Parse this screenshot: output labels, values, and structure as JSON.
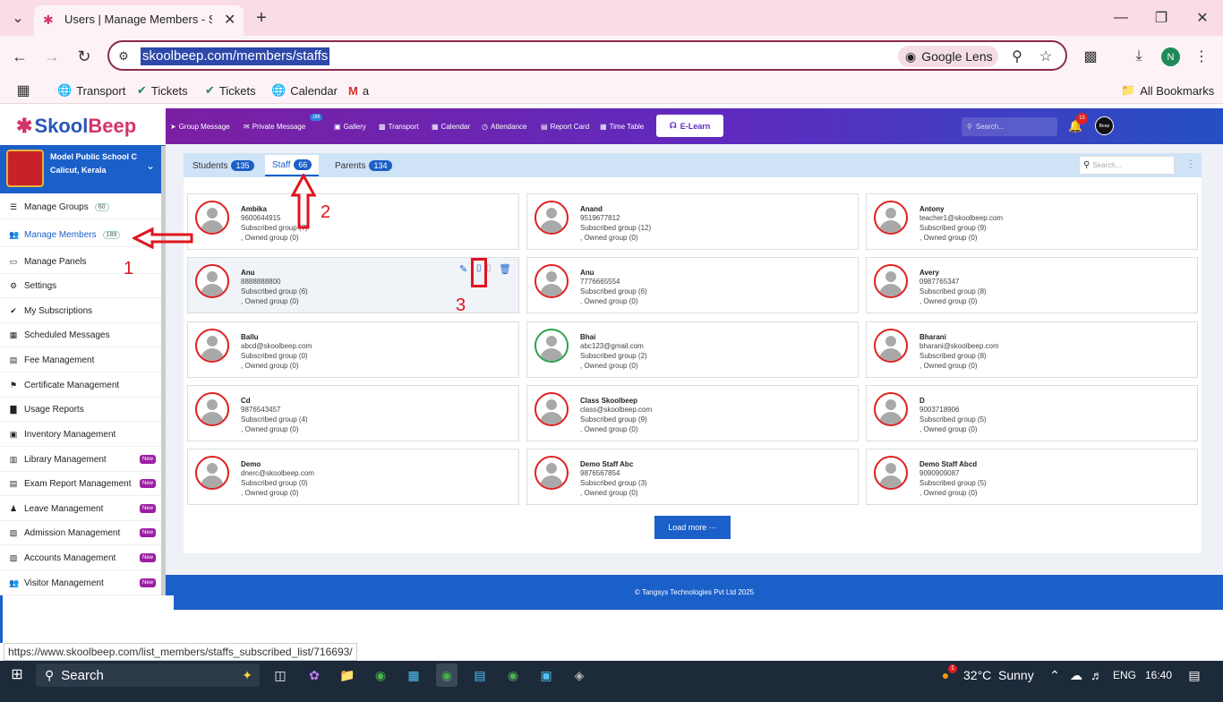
{
  "browser": {
    "tab_title": "Users | Manage Members - Staf",
    "url": "skoolbeep.com/members/staffs",
    "lens_label": "Google Lens",
    "profile_initial": "N",
    "bookmarks": [
      "Transport",
      "Tickets",
      "Tickets",
      "Calendar",
      "a"
    ],
    "all_bookmarks": "All Bookmarks",
    "status_url": "https://www.skoolbeep.com/list_members/staffs_subscribed_list/716693/"
  },
  "app": {
    "logo_a": "Skool",
    "logo_b": "Beep",
    "school_name": "Model Public School C",
    "school_location": "Calicut, Kerala",
    "topnav": [
      "Group Message",
      "Private Message",
      "Gallery",
      "Transport",
      "Calendar",
      "Attendance",
      "Report Card",
      "Time Table"
    ],
    "private_msg_badge": "189",
    "elearn": "E-Learn",
    "search_placeholder": "Search...",
    "notif_count": "15",
    "avatar_label": "Beep"
  },
  "sidebar": {
    "items": [
      {
        "label": "Manage Groups",
        "icon": "list-icon",
        "count": "60",
        "new": ""
      },
      {
        "label": "Manage Members",
        "icon": "users-icon",
        "count": "189",
        "new": ""
      },
      {
        "label": "Manage Panels",
        "icon": "monitor-icon",
        "count": "",
        "new": ""
      },
      {
        "label": "Settings",
        "icon": "gear-icon",
        "count": "",
        "new": ""
      },
      {
        "label": "My Subscriptions",
        "icon": "check-icon",
        "count": "",
        "new": ""
      },
      {
        "label": "Scheduled Messages",
        "icon": "calendar-icon",
        "count": "",
        "new": ""
      },
      {
        "label": "Fee Management",
        "icon": "file-icon",
        "count": "",
        "new": ""
      },
      {
        "label": "Certificate Management",
        "icon": "certificate-icon",
        "count": "",
        "new": ""
      },
      {
        "label": "Usage Reports",
        "icon": "chart-icon",
        "count": "",
        "new": ""
      },
      {
        "label": "Inventory Management",
        "icon": "box-icon",
        "count": "",
        "new": ""
      },
      {
        "label": "Library Management",
        "icon": "book-icon",
        "count": "",
        "new": "New"
      },
      {
        "label": "Exam Report Management",
        "icon": "report-icon",
        "count": "",
        "new": "New"
      },
      {
        "label": "Leave Management",
        "icon": "leave-icon",
        "count": "",
        "new": "New"
      },
      {
        "label": "Admission Management",
        "icon": "admission-icon",
        "count": "",
        "new": "New"
      },
      {
        "label": "Accounts Management",
        "icon": "accounts-icon",
        "count": "",
        "new": "New"
      },
      {
        "label": "Visitor Management",
        "icon": "visitor-icon",
        "count": "",
        "new": "New"
      }
    ]
  },
  "tabs": [
    {
      "label": "Students",
      "count": "135"
    },
    {
      "label": "Staff",
      "count": "66"
    },
    {
      "label": "Parents",
      "count": "134"
    }
  ],
  "list_search_placeholder": "Search...",
  "members": [
    {
      "name": "Ambika",
      "contact": "9600644915",
      "subscribed": "Subscribed group (7)",
      "owned": ", Owned group (0)"
    },
    {
      "name": "Anand",
      "contact": "9519677812",
      "subscribed": "Subscribed group (12)",
      "owned": ", Owned group (0)"
    },
    {
      "name": "Antony",
      "contact": "teacher1@skoolbeep.com",
      "subscribed": "Subscribed group (9)",
      "owned": ", Owned group (0)"
    },
    {
      "name": "Anu",
      "contact": "8888888800",
      "subscribed": "Subscribed group (6)",
      "owned": ", Owned group (0)"
    },
    {
      "name": "Anu",
      "contact": "7776665554",
      "subscribed": "Subscribed group (6)",
      "owned": ", Owned group (0)"
    },
    {
      "name": "Avery",
      "contact": "0987765347",
      "subscribed": "Subscribed group (8)",
      "owned": ", Owned group (0)"
    },
    {
      "name": "Ballu",
      "contact": "abcd@skoolbeep.com",
      "subscribed": "Subscribed group (0)",
      "owned": ", Owned group (0)"
    },
    {
      "name": "Bhai",
      "contact": "abc123@gmail.com",
      "subscribed": "Subscribed group (2)",
      "owned": ", Owned group (0)"
    },
    {
      "name": "Bharani",
      "contact": "bharani@skoolbeep.com",
      "subscribed": "Subscribed group (8)",
      "owned": ", Owned group (0)"
    },
    {
      "name": "Cd",
      "contact": "9876543457",
      "subscribed": "Subscribed group (4)",
      "owned": ", Owned group (0)"
    },
    {
      "name": "Class Skoolbeep",
      "contact": "class@skoolbeep.com",
      "subscribed": "Subscribed group (9)",
      "owned": ", Owned group (0)"
    },
    {
      "name": "D",
      "contact": "9003718906",
      "subscribed": "Subscribed group (5)",
      "owned": ", Owned group (0)"
    },
    {
      "name": "Demo",
      "contact": "dnerc@skoolbeep.com",
      "subscribed": "Subscribed group (0)",
      "owned": ", Owned group (0)"
    },
    {
      "name": "Demo Staff Abc",
      "contact": "9876567854",
      "subscribed": "Subscribed group (3)",
      "owned": ", Owned group (0)"
    },
    {
      "name": "Demo Staff Abcd",
      "contact": "9090909087",
      "subscribed": "Subscribed group (5)",
      "owned": ", Owned group (0)"
    }
  ],
  "load_more": "Load more ···",
  "footer": "© Tangsys Technologies Pvt Ltd 2025",
  "annotations": {
    "a1": "1",
    "a2": "2",
    "a3": "3"
  },
  "taskbar": {
    "search": "Search",
    "weather_temp": "32°C",
    "weather_cond": "Sunny",
    "weather_badge": "1",
    "lang": "ENG",
    "time": "16:40"
  },
  "colors": {
    "brand_blue": "#1b5fc9",
    "nav_purple": "#7b1fa2",
    "annotation_red": "#e0141e",
    "new_badge": "#9b1fa5"
  }
}
